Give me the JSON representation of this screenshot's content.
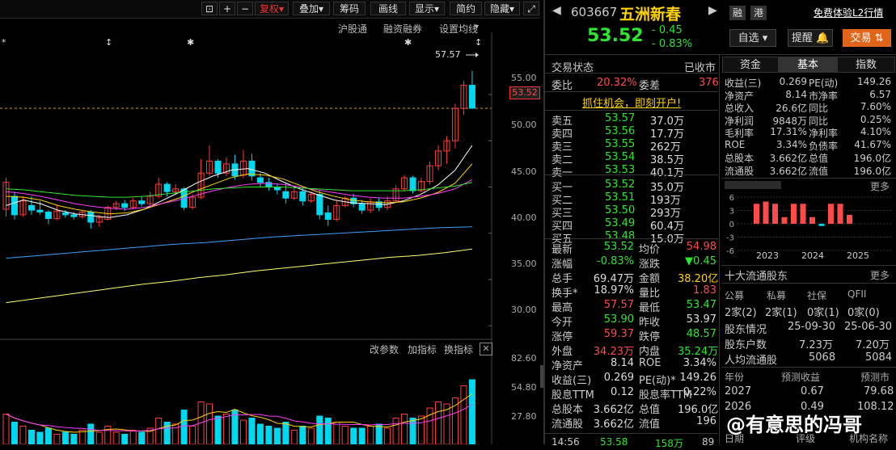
{
  "toolbar": {
    "buttons": [
      "复权",
      "叠加",
      "筹码",
      "画线",
      "显示",
      "简约",
      "隐藏"
    ],
    "links": [
      "沪股通",
      "融资融券",
      "设置均线"
    ],
    "ind_links": [
      "改参数",
      "加指标",
      "换指标"
    ]
  },
  "chart": {
    "price_axis": [
      "55.00",
      "50.00",
      "45.00",
      "40.00",
      "35.00",
      "30.00"
    ],
    "current_price_tag": "53.52",
    "high_marker": "57.57",
    "vol_axis": [
      "82.60",
      "54.80",
      "27.80"
    ],
    "candle_up_color": "#ff3b3b",
    "candle_down_color": "#00d8f0",
    "ma_colors": [
      "#ffffff",
      "#ffd200",
      "#ff3cff",
      "#2ee62e",
      "#3ca0ff",
      "#ffff66"
    ]
  },
  "stock": {
    "code": "603667",
    "name": "五洲新春",
    "tags": [
      "融",
      "港"
    ],
    "l2_link": "免费体验L2行情",
    "price": "53.52",
    "change": "- 0.45",
    "change_pct": "- 0.83%",
    "zixuan": "自选",
    "tixing": "提醒",
    "jiaoyi": "交易"
  },
  "status": {
    "label": "交易状态",
    "value": "已收市"
  },
  "weibi": {
    "label1": "委比",
    "val1": "20.32%",
    "label2": "委差",
    "val2": "376"
  },
  "promo": "抓住机会，即刻开户!",
  "sell": [
    {
      "label": "卖五",
      "price": "53.57",
      "vol": "37.0万"
    },
    {
      "label": "卖四",
      "price": "53.56",
      "vol": "17.7万"
    },
    {
      "label": "卖三",
      "price": "53.55",
      "vol": "262万"
    },
    {
      "label": "卖二",
      "price": "53.54",
      "vol": "38.5万"
    },
    {
      "label": "卖一",
      "price": "53.53",
      "vol": "40.1万"
    }
  ],
  "buy": [
    {
      "label": "买一",
      "price": "53.52",
      "vol": "35.0万"
    },
    {
      "label": "买二",
      "price": "53.51",
      "vol": "193万"
    },
    {
      "label": "买三",
      "price": "53.50",
      "vol": "293万"
    },
    {
      "label": "买四",
      "price": "53.49",
      "vol": "60.4万"
    },
    {
      "label": "买五",
      "price": "53.48",
      "vol": "15.0万"
    }
  ],
  "quote": [
    [
      "最新",
      "53.52",
      "均价",
      "54.98"
    ],
    [
      "涨幅",
      "-0.83%",
      "涨跌",
      "▼0.45"
    ],
    [
      "总手",
      "69.47万",
      "金额",
      "38.20亿"
    ],
    [
      "换手*",
      "18.97%",
      "量比",
      "1.83"
    ],
    [
      "最高",
      "57.57",
      "最低",
      "53.47"
    ],
    [
      "今开",
      "53.90",
      "昨收",
      "53.97"
    ],
    [
      "涨停",
      "59.37",
      "跌停",
      "48.57"
    ],
    [
      "外盘",
      "34.23万",
      "内盘",
      "35.24万"
    ],
    [
      "净资产",
      "8.14",
      "ROE",
      "3.34%"
    ],
    [
      "收益(三)",
      "0.269",
      "PE(动)*",
      "149.26"
    ],
    [
      "股息TTM",
      "0.12",
      "股息率TTM",
      "0.22%"
    ],
    [
      "总股本",
      "3.662亿",
      "总值",
      "196.0亿"
    ],
    [
      "流通股",
      "3.662亿",
      "流值",
      "196"
    ]
  ],
  "bottom_tick": [
    "14:56",
    "53.58",
    "158万",
    "89"
  ],
  "tabs": [
    "资金",
    "基本",
    "指数"
  ],
  "fund": [
    [
      "收益(三)",
      "0.269",
      "PE(动)",
      "149.26"
    ],
    [
      "净资产",
      "8.14",
      "市净率",
      "6.57"
    ],
    [
      "总收入",
      "26.6亿",
      "同比",
      "7.60%"
    ],
    [
      "净利润",
      "9848万",
      "同比",
      "0.25%"
    ],
    [
      "毛利率",
      "17.31%",
      "净利率",
      "4.10%"
    ],
    [
      "ROE",
      "3.34%",
      "负债率",
      "41.67%"
    ],
    [
      "总股本",
      "3.662亿",
      "总值",
      "196.0亿"
    ],
    [
      "流通股",
      "3.662亿",
      "流值",
      "196.0亿"
    ]
  ],
  "more": "更多",
  "mini_chart": {
    "y_ticks": [
      "6",
      "3",
      "0",
      "-3",
      "-6"
    ],
    "x_labels": [
      "2023",
      "2024",
      "2025"
    ],
    "bars": [
      4.5,
      5,
      4.5,
      1.5,
      4.5,
      4.5,
      1.5,
      -0.5,
      4.5,
      4.5,
      2
    ]
  },
  "holders": {
    "title": "十大流通股东",
    "more": "更多",
    "types": [
      "公募",
      "私募",
      "社保",
      "QFII"
    ],
    "counts": [
      "2家(2)",
      "2家(1)",
      "0家(1)",
      "0家(0)"
    ],
    "situation_label": "股东情况",
    "date1": "25-09-30",
    "date2": "25-06-30",
    "count_label": "股东户数",
    "count1": "7.23万",
    "count2": "7.20万",
    "per_label": "人均流通股",
    "per1": "5068",
    "per2": "5084"
  },
  "forecast": {
    "h1": "年份",
    "h2": "预测收益",
    "h3": "预测市",
    "rows": [
      [
        "2027",
        "0.67",
        "79.68"
      ],
      [
        "2026",
        "0.49",
        "108.12"
      ]
    ],
    "foot1": "日期",
    "foot2": "评级",
    "foot3": "机构名称"
  },
  "watermark": "@有意思的冯哥"
}
